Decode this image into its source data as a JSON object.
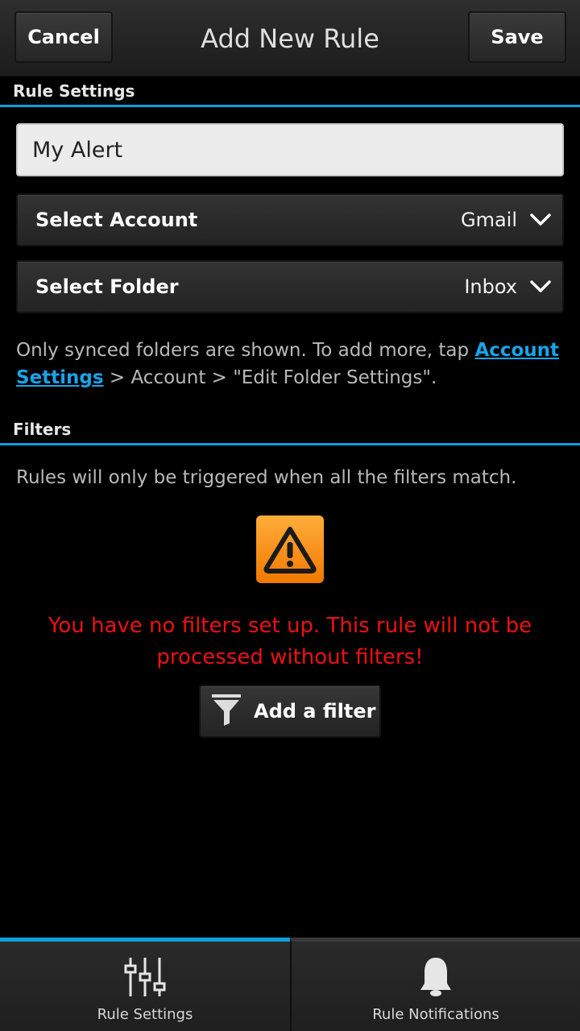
{
  "header": {
    "title": "Add New Rule",
    "cancel_label": "Cancel",
    "save_label": "Save"
  },
  "rule_settings": {
    "section_title": "Rule Settings",
    "name_value": "My Alert",
    "account": {
      "label": "Select Account",
      "value": "Gmail"
    },
    "folder": {
      "label": "Select Folder",
      "value": "Inbox"
    },
    "info_prefix": "Only synced folders are shown. To add more, tap ",
    "info_link": "Account Settings",
    "info_suffix": " > Account > \"Edit Folder Settings\"."
  },
  "filters": {
    "section_title": "Filters",
    "info": "Rules will only be triggered when all the filters match.",
    "warning": "You have no filters set up. This rule will not be processed without filters!",
    "add_label": "Add a filter",
    "warning_icon": "warning-icon",
    "add_icon": "filter-funnel-icon"
  },
  "tabs": [
    {
      "label": "Rule Settings",
      "icon": "sliders-icon",
      "active": true
    },
    {
      "label": "Rule Notifications",
      "icon": "bell-icon",
      "active": false
    }
  ],
  "colors": {
    "accent": "#0e9fe0",
    "warning_text": "#ee1111",
    "link": "#1aa3e8",
    "warning_icon_bg": "#f58a10"
  }
}
